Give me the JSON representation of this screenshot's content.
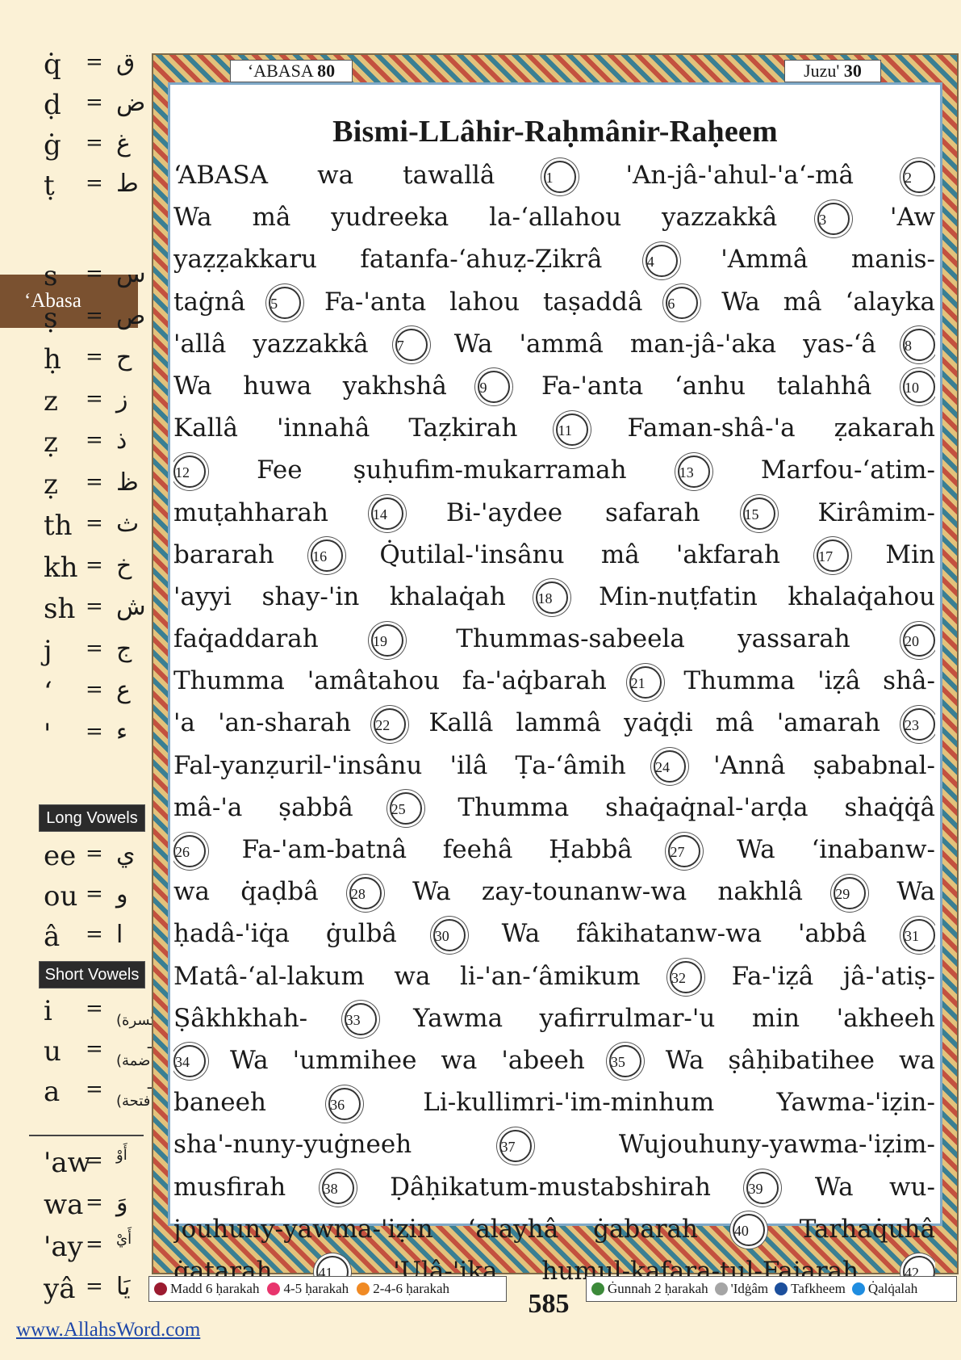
{
  "sidebar": {
    "consonants_top": [
      {
        "latin": "q̇",
        "arabic": "ق"
      },
      {
        "latin": "ḍ",
        "arabic": "ض"
      },
      {
        "latin": "ġ",
        "arabic": "غ"
      },
      {
        "latin": "ṭ",
        "arabic": "ط"
      }
    ],
    "surah_tab": "‘Abasa",
    "consonants_bottom": [
      {
        "latin": "s",
        "arabic": "س"
      },
      {
        "latin": "ṣ",
        "arabic": "ص"
      },
      {
        "latin": "ḥ",
        "arabic": "ح"
      },
      {
        "latin": "z",
        "arabic": "ز"
      },
      {
        "latin": "ẓ",
        "arabic": "ذ"
      },
      {
        "latin": "ẓ",
        "arabic": "ظ"
      },
      {
        "latin": "th",
        "arabic": "ث"
      },
      {
        "latin": "kh",
        "arabic": "خ"
      },
      {
        "latin": "sh",
        "arabic": "ش"
      },
      {
        "latin": "j",
        "arabic": "ج"
      },
      {
        "latin": "‘",
        "arabic": "ع"
      },
      {
        "latin": "'",
        "arabic": "ء"
      }
    ],
    "long_vowels_label": "Long Vowels",
    "long_vowels": [
      {
        "latin": "ee",
        "arabic": "ي"
      },
      {
        "latin": "ou",
        "arabic": "و"
      },
      {
        "latin": "â",
        "arabic": "ا"
      }
    ],
    "short_vowels_label": "Short Vowels",
    "short_vowels": [
      {
        "latin": "i",
        "arabic": "ـِـ (كسرة)"
      },
      {
        "latin": "u",
        "arabic": "ـُـ (ضمة)"
      },
      {
        "latin": "a",
        "arabic": "ـَـ (فتحة)"
      }
    ],
    "diphthongs": [
      {
        "latin": "'aw",
        "arabic": "أَوْ"
      },
      {
        "latin": "wa",
        "arabic": "وَ"
      },
      {
        "latin": "'ay",
        "arabic": "أَيْ"
      },
      {
        "latin": "yâ",
        "arabic": "يَا"
      }
    ],
    "website": "www.AllahsWord.com"
  },
  "header": {
    "surah_name": "‘ABASA",
    "surah_number": "80",
    "juz_label": "Juzu'",
    "juz_number": "30"
  },
  "basmala": "Bismi-LLâhir-Raḥmânir-Raḥeem",
  "colors": {
    "madd6": "#9b1b30",
    "madd45": "#e8356d",
    "madd246": "#f08a24",
    "ghunnah": "#3c8a3a",
    "idgham": "#a5a5a5",
    "tafkheem": "#1c4f9c",
    "qalqalah": "#1f8de0"
  },
  "verse_lines": [
    [
      {
        "t": "‘ABASA wa tawallâ"
      },
      {
        "n": "1"
      },
      {
        "t": "'An-jâ-'ahul-'a‘-mâ"
      },
      {
        "n": "2"
      }
    ],
    [
      {
        "t": "Wa mâ yudreeka la-‘allahou yazzakkâ"
      },
      {
        "n": "3"
      },
      {
        "t": "'Aw"
      }
    ],
    [
      {
        "t": "yaẓẓakkaru fatanfa-‘ahuẓ-Ẓikrâ"
      },
      {
        "n": "4"
      },
      {
        "t": "'Ammâ manis-"
      }
    ],
    [
      {
        "t": "taġnâ"
      },
      {
        "n": "5"
      },
      {
        "t": "Fa-'anta lahou taṣaddâ"
      },
      {
        "n": "6"
      },
      {
        "t": "Wa mâ ‘alayka"
      }
    ],
    [
      {
        "t": "'allâ yazzakkâ"
      },
      {
        "n": "7"
      },
      {
        "t": "Wa 'ammâ man-jâ-'aka yas-‘â"
      },
      {
        "n": "8"
      }
    ],
    [
      {
        "t": "Wa huwa yakhshâ"
      },
      {
        "n": "9"
      },
      {
        "t": "Fa-'anta ‘anhu talahhâ"
      },
      {
        "n": "10"
      }
    ],
    [
      {
        "t": "Kallâ 'innahâ Taẓkirah"
      },
      {
        "n": "11"
      },
      {
        "t": "Faman-shâ-'a ẓakarah"
      }
    ],
    [
      {
        "n": "12"
      },
      {
        "t": "Fee ṣuḥufim-mukarramah"
      },
      {
        "n": "13"
      },
      {
        "t": "Marfou-‘atim-"
      }
    ],
    [
      {
        "t": "muṭahharah"
      },
      {
        "n": "14"
      },
      {
        "t": "Bi-'aydee safarah"
      },
      {
        "n": "15"
      },
      {
        "t": "Kirâmim-"
      }
    ],
    [
      {
        "t": "bararah"
      },
      {
        "n": "16"
      },
      {
        "t": "Q̇utilal-'insânu mâ 'akfarah"
      },
      {
        "n": "17"
      },
      {
        "t": "Min"
      }
    ],
    [
      {
        "t": "'ayyi shay-'in khalaq̇ah"
      },
      {
        "n": "18"
      },
      {
        "t": "Min-nuṭfatin khalaq̇ahou"
      }
    ],
    [
      {
        "t": "faq̇addarah"
      },
      {
        "n": "19"
      },
      {
        "t": "Thummas-sabeela yassarah"
      },
      {
        "n": "20"
      }
    ],
    [
      {
        "t": "Thumma 'amâtahou fa-'aq̇barah"
      },
      {
        "n": "21"
      },
      {
        "t": "Thumma 'iẓâ shâ-"
      }
    ],
    [
      {
        "t": "'a 'an-sharah"
      },
      {
        "n": "22"
      },
      {
        "t": "Kallâ lammâ yaq̇ḍi mâ 'amarah"
      },
      {
        "n": "23"
      }
    ],
    [
      {
        "t": "Fal-yanẓuril-'insânu 'ilâ Ṭa-‘âmih"
      },
      {
        "n": "24"
      },
      {
        "t": "'Annâ ṣababnal-"
      }
    ],
    [
      {
        "t": "mâ-'a ṣabbâ"
      },
      {
        "n": "25"
      },
      {
        "t": "Thumma shaq̇aq̇nal-'arḍa shaq̇q̇â"
      }
    ],
    [
      {
        "n": "26"
      },
      {
        "t": "Fa-'am-batnâ feehâ Ḥabbâ"
      },
      {
        "n": "27"
      },
      {
        "t": "Wa ‘inabanw-"
      }
    ],
    [
      {
        "t": "wa q̇aḍbâ"
      },
      {
        "n": "28"
      },
      {
        "t": "Wa zay-tounanw-wa nakhlâ"
      },
      {
        "n": "29"
      },
      {
        "t": "Wa"
      }
    ],
    [
      {
        "t": "ḥadâ-'iq̇a ġulbâ"
      },
      {
        "n": "30"
      },
      {
        "t": "Wa fâkihatanw-wa 'abbâ"
      },
      {
        "n": "31"
      }
    ],
    [
      {
        "t": "Matâ-‘al-lakum wa li-'an-‘âmikum"
      },
      {
        "n": "32"
      },
      {
        "t": "Fa-'iẓâ jâ-'atiṣ-"
      }
    ],
    [
      {
        "t": "Ṣâkhkhah-"
      },
      {
        "n": "33"
      },
      {
        "t": "Yawma yafirrulmar-'u min 'akheeh"
      }
    ],
    [
      {
        "n": "34"
      },
      {
        "t": "Wa 'ummihee wa 'abeeh"
      },
      {
        "n": "35"
      },
      {
        "t": "Wa ṣâḥibatihee wa"
      }
    ],
    [
      {
        "t": "baneeh"
      },
      {
        "n": "36"
      },
      {
        "t": "Li-kullimri-'im-minhum Yawma-'iẓin-"
      }
    ],
    [
      {
        "t": "sha'-nuny-yuġneeh"
      },
      {
        "n": "37"
      },
      {
        "t": "Wujouhuny-yawma-'iẓim-"
      }
    ],
    [
      {
        "t": "musfirah"
      },
      {
        "n": "38"
      },
      {
        "t": "Ḍâḥikatum-mustabshirah"
      },
      {
        "n": "39"
      },
      {
        "t": "Wa wu-"
      }
    ],
    [
      {
        "t": "jouhuny-yawma-'iẓin ‘alayhâ ġabarah"
      },
      {
        "n": "40"
      },
      {
        "t": "Tarhaq̇uhâ"
      }
    ],
    [
      {
        "t": "q̇atarah"
      },
      {
        "n": "41"
      },
      {
        "t": "'Ulâ-'ika humul-kafara-tul-Fajarah"
      },
      {
        "n": "42"
      }
    ]
  ],
  "legend_left": [
    {
      "label": "Madd 6 ḥarakah",
      "color_key": "madd6"
    },
    {
      "label": "4-5 ḥarakah",
      "color_key": "madd45"
    },
    {
      "label": "2-4-6 ḥarakah",
      "color_key": "madd246"
    }
  ],
  "legend_right": [
    {
      "label": "Ġunnah 2 ḥarakah",
      "color_key": "ghunnah"
    },
    {
      "label": "'Idġâm",
      "color_key": "idgham"
    },
    {
      "label": "Tafkheem",
      "color_key": "tafkheem"
    },
    {
      "label": "Q̇alq̇alah",
      "color_key": "qalqalah"
    }
  ],
  "page_number": "585"
}
